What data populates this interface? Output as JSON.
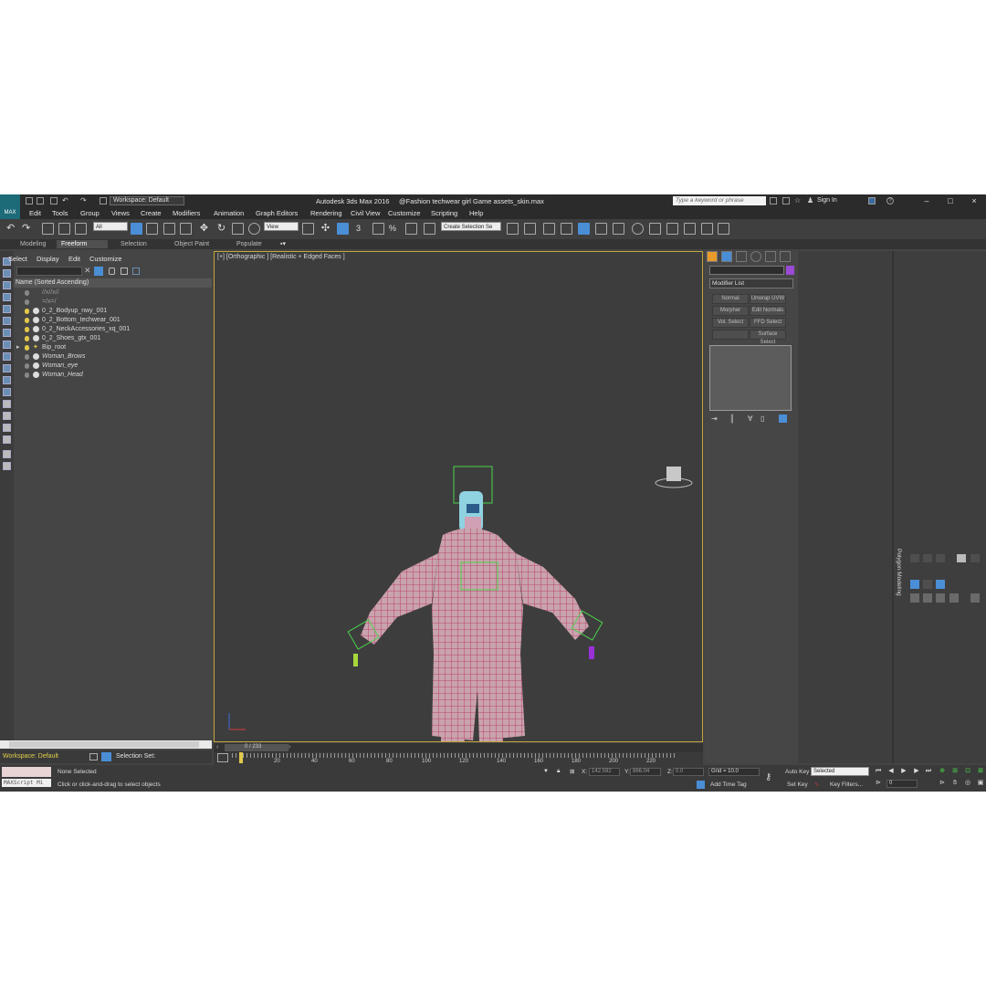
{
  "titlebar": {
    "logo_text": "MAX",
    "workspace": "Workspace: Default",
    "app_title": "Autodesk 3ds Max 2016",
    "file_title": "@Fashion techwear girl Game assets_skin.max",
    "search_placeholder": "Type a keyword or phrase",
    "sign_in": "Sign In",
    "minimize": "–",
    "maximize": "□",
    "close": "×"
  },
  "menu": [
    "Edit",
    "Tools",
    "Group",
    "Views",
    "Create",
    "Modifiers",
    "Animation",
    "Graph Editors",
    "Rendering",
    "Civil View",
    "Customize",
    "Scripting",
    "Help"
  ],
  "toolbar": {
    "filter_value": "All",
    "view_value": "View",
    "create_selection_set": "Create Selection Se"
  },
  "ribbon_tabs": [
    "Modeling",
    "Freeform",
    "Selection",
    "Object Paint",
    "Populate"
  ],
  "explorer": {
    "menu": [
      "Select",
      "Display",
      "Edit",
      "Customize"
    ],
    "header": "Name (Sorted Ascending)",
    "rows": [
      {
        "label": "//x//x//",
        "faint": true
      },
      {
        "label": "=/x=/",
        "faint": true
      },
      {
        "label": "0_2_Bodyup_nwy_001"
      },
      {
        "label": "0_2_Bottom_techwear_001"
      },
      {
        "label": "0_2_NeckAccessories_xq_001"
      },
      {
        "label": "0_2_Shoes_gtx_001"
      },
      {
        "label": "Bip_root"
      },
      {
        "label": "Woman_Brows",
        "italic": true
      },
      {
        "label": "Woman_eye",
        "italic": true
      },
      {
        "label": "Woman_Head",
        "italic": true
      }
    ],
    "workspace": "Workspace: Default",
    "selection_set": "Selection Set:"
  },
  "viewport": {
    "label": "[+] [Orthographic ] [Realistic + Edged Faces ]"
  },
  "timeline": {
    "position": "0 / 233",
    "ticks": [
      "20",
      "40",
      "60",
      "80",
      "100",
      "120",
      "140",
      "160",
      "180",
      "200",
      "220"
    ]
  },
  "command_panel": {
    "modifier_list": "Modifier List",
    "buttons": [
      "Normal",
      "Unwrap UVW",
      "Morpher",
      "Edit Normals",
      "Vol. Select",
      "FFD Select",
      "",
      "Surface Select"
    ],
    "object_color": "#9a4bd6"
  },
  "poly_modeling": "Polygon Modeling",
  "status": {
    "maxscript": "MAXScript Mi",
    "none_selected": "None Selected",
    "prompt": "Click or click-and-drag to select objects",
    "x_label": "X:",
    "x_value": "142.592",
    "y_label": "Y:",
    "y_value": "866.04",
    "z_label": "Z:",
    "z_value": "0.0",
    "grid": "Grid = 10.0",
    "add_time_tag": "Add Time Tag",
    "auto_key": "Auto Key",
    "set_key": "Set Key",
    "selected": "Selected",
    "key_filters": "Key Filters...",
    "frame": "0"
  }
}
